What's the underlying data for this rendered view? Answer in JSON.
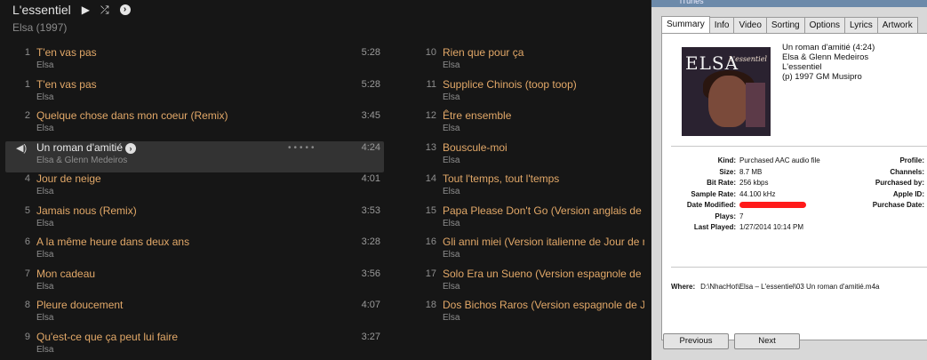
{
  "album": {
    "title": "L'essentiel",
    "subtitle": "Elsa (1997)",
    "icons": [
      "play-icon",
      "shuffle-icon",
      "more-icon"
    ]
  },
  "tracks_left": [
    {
      "num": "1",
      "title": "T'en vas pas",
      "artist": "Elsa",
      "duration": "5:28"
    },
    {
      "num": "1",
      "title": "T'en vas pas",
      "artist": "Elsa",
      "duration": "5:28"
    },
    {
      "num": "2",
      "title": "Quelque chose dans mon coeur (Remix)",
      "artist": "Elsa",
      "duration": "3:45"
    },
    {
      "num": "",
      "title": "Un roman d'amitié",
      "artist": "Elsa & Glenn Medeiros",
      "duration": "4:24",
      "active": true
    },
    {
      "num": "4",
      "title": "Jour de neige",
      "artist": "Elsa",
      "duration": "4:01"
    },
    {
      "num": "5",
      "title": "Jamais nous (Remix)",
      "artist": "Elsa",
      "duration": "3:53"
    },
    {
      "num": "6",
      "title": "A la même heure dans deux ans",
      "artist": "Elsa",
      "duration": "3:28"
    },
    {
      "num": "7",
      "title": "Mon cadeau",
      "artist": "Elsa",
      "duration": "3:56"
    },
    {
      "num": "8",
      "title": "Pleure doucement",
      "artist": "Elsa",
      "duration": "4:07"
    },
    {
      "num": "9",
      "title": "Qu'est-ce que ça peut lui faire",
      "artist": "Elsa",
      "duration": "3:27"
    }
  ],
  "tracks_right": [
    {
      "num": "10",
      "title": "Rien que pour ça",
      "artist": "Elsa"
    },
    {
      "num": "11",
      "title": "Supplice Chinois (toop toop)",
      "artist": "Elsa"
    },
    {
      "num": "12",
      "title": "Être ensemble",
      "artist": "Elsa"
    },
    {
      "num": "13",
      "title": "Bouscule-moi",
      "artist": "Elsa"
    },
    {
      "num": "14",
      "title": "Tout l'temps, tout l'temps",
      "artist": "Elsa"
    },
    {
      "num": "15",
      "title": "Papa Please Don't Go (Version anglais de T'e",
      "artist": "Elsa"
    },
    {
      "num": "16",
      "title": "Gli anni miei (Version italienne de Jour de ne",
      "artist": "Elsa"
    },
    {
      "num": "17",
      "title": "Solo Era un Sueno (Version espagnole de Jou",
      "artist": "Elsa"
    },
    {
      "num": "18",
      "title": "Dos Bichos Raros (Version espagnole de Jam",
      "artist": "Elsa"
    }
  ],
  "dialog": {
    "window_title": "iTunes",
    "tabs": [
      "Summary",
      "Info",
      "Video",
      "Sorting",
      "Options",
      "Lyrics",
      "Artwork"
    ],
    "selected_tab": "Summary",
    "artwork": {
      "brand": "ELSA",
      "title": "L'essentiel"
    },
    "summary_lines": [
      "Un roman d'amitié (4:24)",
      "Elsa & Glenn Medeiros",
      "L'essentiel",
      "(p) 1997 GM Musipro"
    ],
    "meta_left": [
      {
        "key": "Kind:",
        "value": "Purchased AAC audio file"
      },
      {
        "key": "Size:",
        "value": "8.7 MB"
      },
      {
        "key": "Bit Rate:",
        "value": "256 kbps"
      },
      {
        "key": "Sample Rate:",
        "value": "44.100 kHz"
      },
      {
        "key": "Date Modified:",
        "value": ""
      },
      {
        "key": "Plays:",
        "value": "7"
      },
      {
        "key": "Last Played:",
        "value": "1/27/2014 10:14 PM"
      }
    ],
    "meta_right": [
      "Profile:",
      "Channels:",
      "Purchased by:",
      "Apple ID:",
      "Purchase Date:"
    ],
    "where_label": "Where:",
    "where_value": "D:\\NhacHot\\Elsa – L'essentiel\\03 Un roman d'amitié.m4a",
    "previous_label": "Previous",
    "next_label": "Next"
  }
}
